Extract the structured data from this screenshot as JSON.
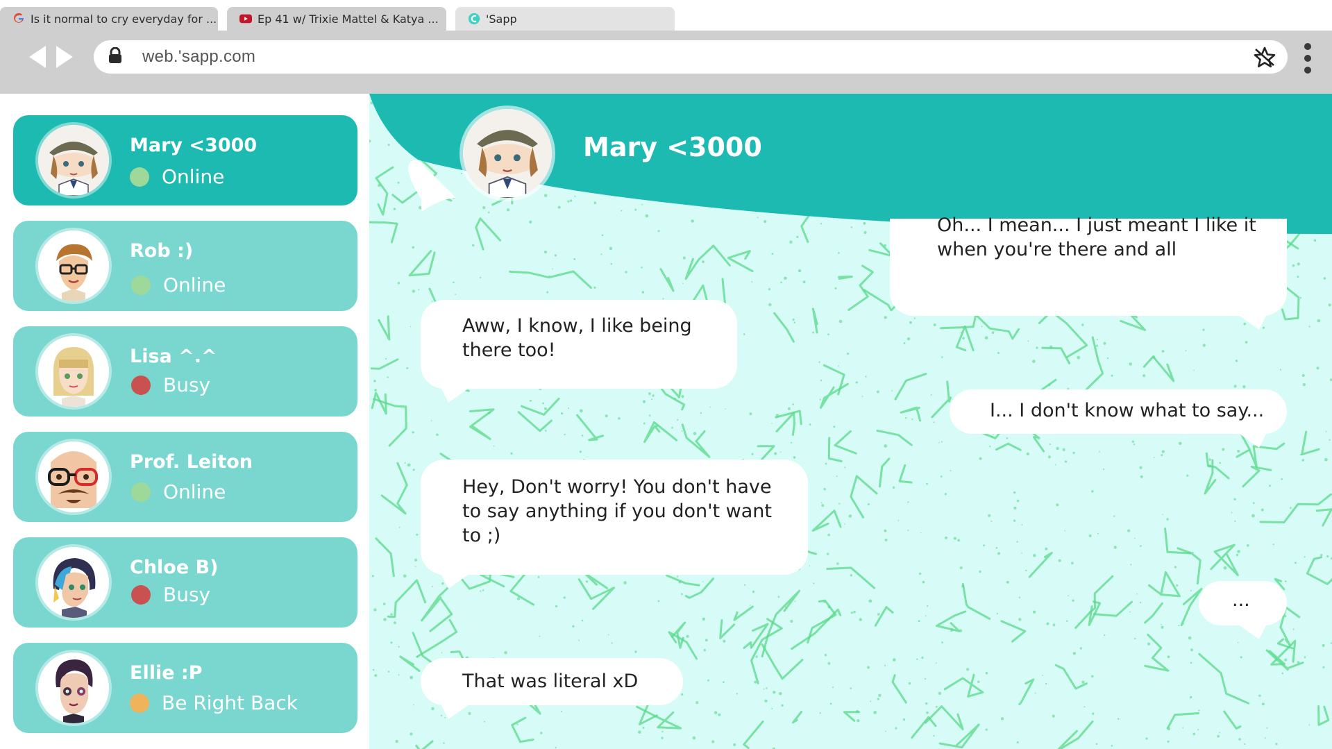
{
  "browser": {
    "tabs": [
      {
        "title": "Is it normal to cry everyday for ...",
        "icon": "google-icon",
        "active": false
      },
      {
        "title": "Ep 41 w/ Trixie Mattel & Katya ...",
        "icon": "youtube-icon",
        "active": false
      },
      {
        "title": "'Sapp",
        "icon": "sapp-icon",
        "active": true
      }
    ],
    "url": "web.'sapp.com"
  },
  "sidebar": {
    "contacts": [
      {
        "name": "Mary <3000",
        "status": "Online",
        "status_color": "#9fd99a",
        "active": true
      },
      {
        "name": "Rob :)",
        "status": "Online",
        "status_color": "#9fd99a",
        "active": false
      },
      {
        "name": "Lisa ^.^",
        "status": "Busy",
        "status_color": "#c9514f",
        "active": false
      },
      {
        "name": "Prof. Leiton",
        "status": "Online",
        "status_color": "#9fd99a",
        "active": false
      },
      {
        "name": "Chloe B)",
        "status": "Busy",
        "status_color": "#c9514f",
        "active": false
      },
      {
        "name": "Ellie :P",
        "status": "Be Right Back",
        "status_color": "#efb35c",
        "active": false
      }
    ]
  },
  "chat": {
    "title": "Mary <3000",
    "messages": [
      {
        "side": "right",
        "text": "Oh... I mean... I just meant I like it when you're there and all"
      },
      {
        "side": "left",
        "text": "Aww, I know, I like being there too!"
      },
      {
        "side": "right",
        "text": "I... I don't know what to say..."
      },
      {
        "side": "left",
        "text": "Hey, Don't worry! You don't have to say anything if you don't want to ;)"
      },
      {
        "side": "right",
        "text": "..."
      },
      {
        "side": "left",
        "text": "That was literal xD"
      }
    ]
  },
  "colors": {
    "accent": "#1dbab1",
    "contact_bg": "#79d7d0",
    "chat_bg": "#d7fbf7",
    "pattern": "#58d98a",
    "chrome": "#cfcfcf"
  }
}
